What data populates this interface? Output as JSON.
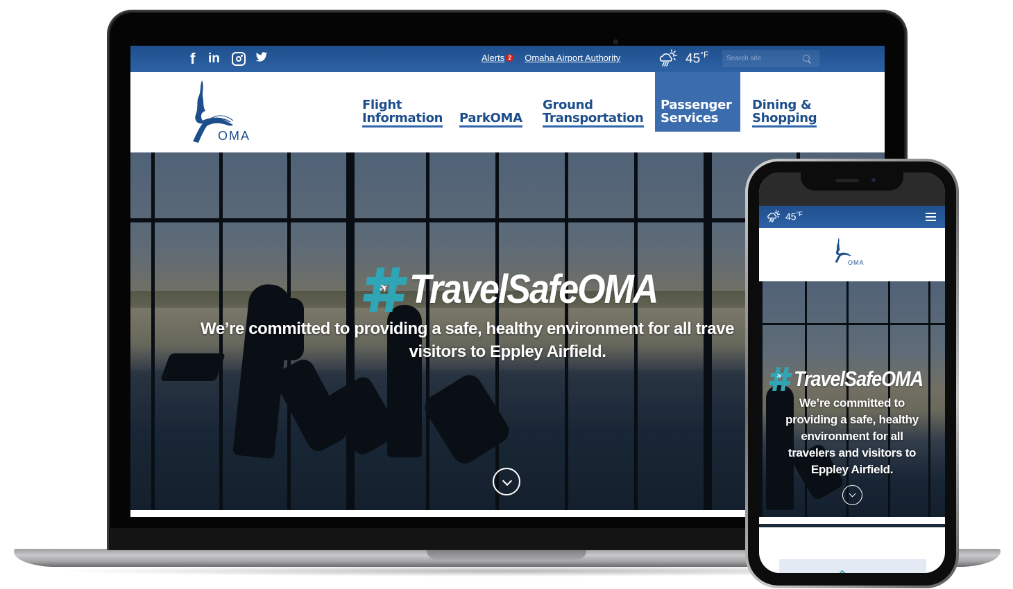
{
  "desktop": {
    "utility_bar": {
      "social": [
        {
          "name": "facebook",
          "glyph": "f"
        },
        {
          "name": "linkedin",
          "glyph": "in"
        },
        {
          "name": "instagram",
          "glyph": ""
        },
        {
          "name": "twitter",
          "glyph": "🐦"
        }
      ],
      "alerts_label": "Alerts",
      "alerts_count": "2",
      "authority_link": "Omaha Airport Authority",
      "weather": {
        "icon": "partly-cloudy-rain-icon",
        "temp": "45",
        "unit": "°F"
      },
      "search_placeholder": "Search site"
    },
    "logo_text": "OMA",
    "nav": [
      {
        "line1": "Flight",
        "line2": "Information",
        "active": false
      },
      {
        "line1": "",
        "line2": "ParkOMA",
        "active": false
      },
      {
        "line1": "Ground",
        "line2": "Transportation",
        "active": false
      },
      {
        "line1": "Passenger",
        "line2": "Services",
        "active": true
      },
      {
        "line1": "Dining &",
        "line2": "Shopping",
        "active": false
      }
    ],
    "hero": {
      "hashtag_symbol": "#",
      "plane_glyph": "✈",
      "title": "TravelSafeOMA",
      "subtitle_line1": "We’re committed to providing a safe, healthy environment for all trave",
      "subtitle_line2": "visitors to Eppley Airfield."
    }
  },
  "mobile": {
    "weather": {
      "icon": "partly-cloudy-rain-icon",
      "temp": "45",
      "unit": "°F"
    },
    "logo_text": "OMA",
    "hero": {
      "hashtag_symbol": "#",
      "plane_glyph": "✈",
      "title": "TravelSafeOMA",
      "subtitle_lines": [
        "We’re committed to",
        "providing a safe, healthy",
        "environment for all",
        "travelers and visitors to",
        "Eppley Airfield."
      ]
    }
  },
  "colors": {
    "brand_blue": "#1d4e8c",
    "bar_blue": "#2d62a5",
    "active_nav": "#3a6cae",
    "hashtag_teal": "#2fa5b5",
    "alert_red": "#d0211b"
  }
}
